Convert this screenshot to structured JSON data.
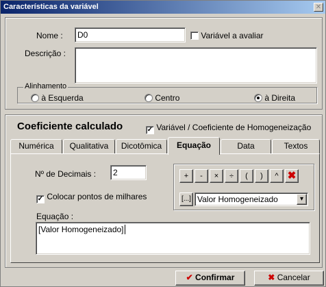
{
  "window": {
    "title": "Características da variável",
    "close_glyph": "✕"
  },
  "variable": {
    "nome_label": "Nome :",
    "nome_value": "D0",
    "avaliar_label": "Variável a avaliar",
    "avaliar_checked": false,
    "descricao_label": "Descrição :",
    "descricao_value": ""
  },
  "alignment": {
    "legend": "Alinhamento",
    "options": [
      {
        "label": "à Esquerda",
        "selected": false
      },
      {
        "label": "Centro",
        "selected": false
      },
      {
        "label": "à Direita",
        "selected": true
      }
    ]
  },
  "coef": {
    "title": "Coeficiente calculado",
    "homog_label": "Variável / Coeficiente de Homogeneização",
    "homog_checked": true,
    "check_glyph": "✓"
  },
  "tabs": [
    {
      "label": "Numérica",
      "active": false
    },
    {
      "label": "Qualitativa",
      "active": false
    },
    {
      "label": "Dicotômica",
      "active": false
    },
    {
      "label": "Equação",
      "active": true
    },
    {
      "label": "Data",
      "active": false
    },
    {
      "label": "Textos",
      "active": false
    }
  ],
  "equacao_tab": {
    "decimais_label": "Nº de Decimais :",
    "decimais_value": "2",
    "milhares_label": "Colocar pontos de milhares",
    "milhares_checked": true,
    "equacao_label": "Equação :",
    "equacao_value": "[Valor Homogeneizado]",
    "operators": [
      "+",
      "-",
      "×",
      "÷",
      "(",
      ")",
      "^"
    ],
    "clear_glyph": "✖",
    "field_button_label": "[...]",
    "field_select_value": "Valor Homogeneizado",
    "dropdown_glyph": "▾"
  },
  "footer": {
    "confirm_label": "Confirmar",
    "cancel_label": "Cancelar"
  },
  "colors": {
    "title_start": "#0a246a",
    "title_end": "#a6caf0",
    "face": "#d4d0c8",
    "clear_red": "#cc0000"
  }
}
